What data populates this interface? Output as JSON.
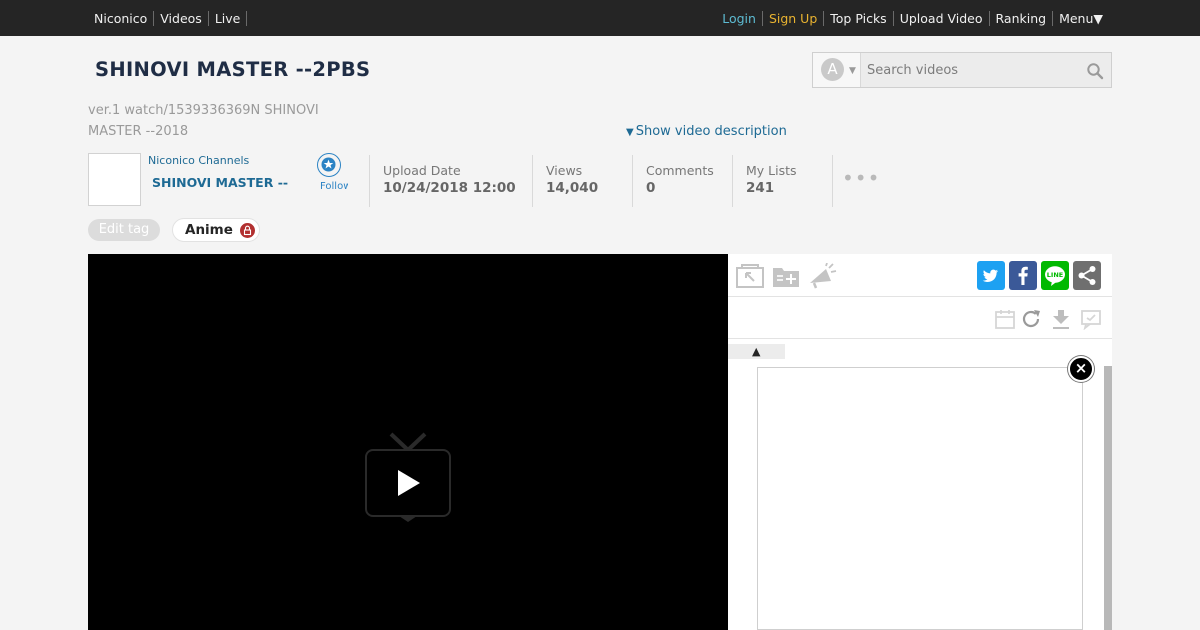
{
  "topbar": {
    "left_links": [
      "Niconico",
      "Videos",
      "Live"
    ],
    "login": "Login",
    "signup": "Sign Up",
    "right_links": [
      "Top Picks",
      "Upload Video",
      "Ranking",
      "Menu▼"
    ]
  },
  "video": {
    "title": "SHINOVI MASTER --2PBS",
    "ver_text": "ver.1 watch/1539336369N SHINOVI MASTER --2018",
    "show_description": "Show video description"
  },
  "search": {
    "type_letter": "A",
    "placeholder": "Search videos"
  },
  "channel": {
    "type_label": "Niconico Channels",
    "name": "SHINOVI MASTER --",
    "follow_label": "Follow"
  },
  "stats": {
    "upload_label": "Upload Date",
    "upload_value": "10/24/2018 12:00",
    "views_label": "Views",
    "views_value": "14,040",
    "comments_label": "Comments",
    "comments_value": "0",
    "mylists_label": "My Lists",
    "mylists_value": "241",
    "more": "•••"
  },
  "tags": {
    "edit_label": "Edit tag",
    "items": [
      "Anime"
    ]
  },
  "comments_panel": {
    "tab_arrow": "▲",
    "close": "×"
  },
  "colors": {
    "topbar_bg": "#252525",
    "login": "#5dbbd2",
    "signup": "#e9b330",
    "link_blue": "#1e6a94",
    "twitter": "#1da1f2",
    "facebook": "#3b5998",
    "line": "#00b900",
    "share_gray": "#6f6f6f"
  },
  "icons": [
    "search-icon",
    "tv-play-icon",
    "star-follow-icon",
    "lock-icon",
    "twitter-icon",
    "facebook-icon",
    "line-icon",
    "share-icon",
    "close-icon"
  ]
}
